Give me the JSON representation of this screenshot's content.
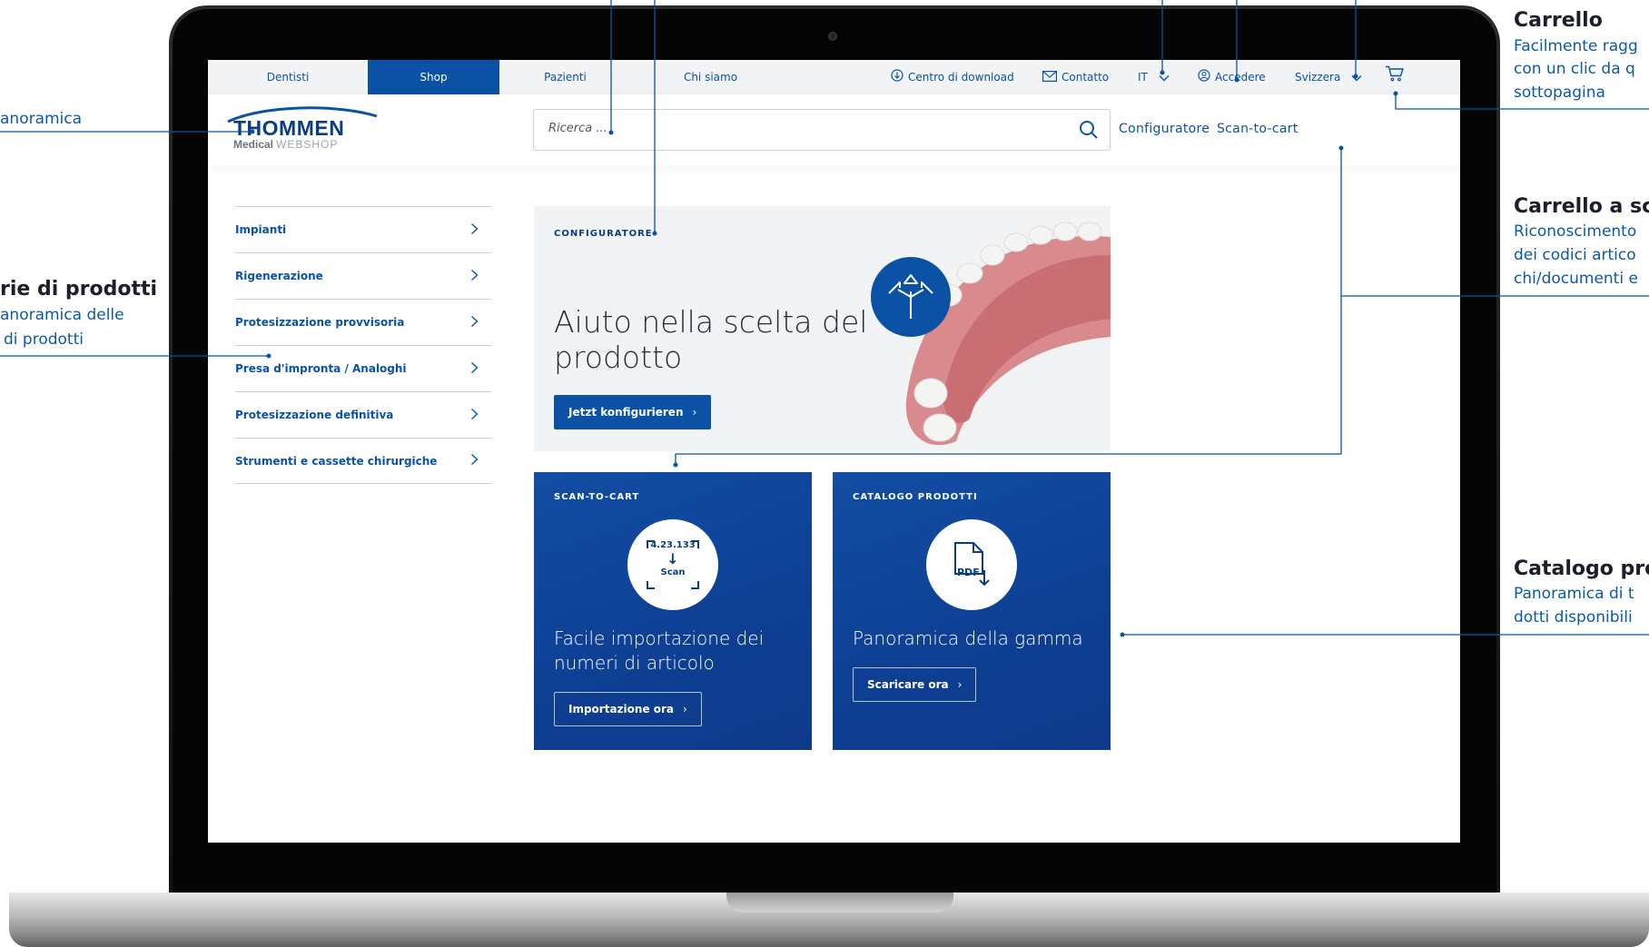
{
  "nav": {
    "tabs": [
      "Dentisti",
      "Shop",
      "Pazienti",
      "Chi siamo"
    ],
    "active_tab": "Shop",
    "download": "Centro di download",
    "contact": "Contatto",
    "language": "IT",
    "login": "Accedere",
    "country": "Svizzera"
  },
  "header": {
    "logo_main": "THOMMEN",
    "logo_sub": "Medical",
    "logo_sub2": "WEBSHOP",
    "search_placeholder": "Ricerca ...",
    "link_configurator": "Configuratore",
    "link_scan": "Scan-to-cart"
  },
  "sidebar": {
    "items": [
      "Impianti",
      "Rigenerazione",
      "Protesizzazione provvisoria",
      "Presa d'impronta / Analoghi",
      "Protesizzazione definitiva",
      "Strumenti e cassette chirurgiche"
    ]
  },
  "configurator": {
    "eyebrow": "CONFIGURATORE",
    "title": "Aiuto nella scelta del prodotto",
    "button": "Jetzt konfigurieren"
  },
  "scan_card": {
    "eyebrow": "SCAN-TO-CART",
    "icon_number": "4.23.133",
    "icon_label": "Scan",
    "title": "Facile importazione dei numeri di articolo",
    "button": "Importazione ora"
  },
  "catalog_card": {
    "eyebrow": "CATALOGO PRODOTTI",
    "icon_label": "PDF",
    "title": "Panoramica della gamma",
    "button": "Scaricare ora"
  },
  "annotations": {
    "left_top": "anoramica",
    "left_cat_title": "rie di prodotti",
    "left_cat_desc_1": "anoramica delle",
    "left_cat_desc_2": "di prodotti",
    "cart_title": "Carrello",
    "cart_desc_1": "Facilmente ragg",
    "cart_desc_2": "con un clic da q",
    "cart_desc_3": "sottopagina",
    "scan_title": "Carrello a sc",
    "scan_desc_1": "Riconoscimento",
    "scan_desc_2": "dei codici artico",
    "scan_desc_3": "chi/documenti e",
    "catalog_title": "Catalogo pro",
    "catalog_desc_1": "Panoramica di t",
    "catalog_desc_2": "dotti disponibili"
  },
  "colors": {
    "brand_blue": "#0b52a6",
    "dark_blue": "#0d3f93",
    "light_bg": "#f1f3f5"
  }
}
